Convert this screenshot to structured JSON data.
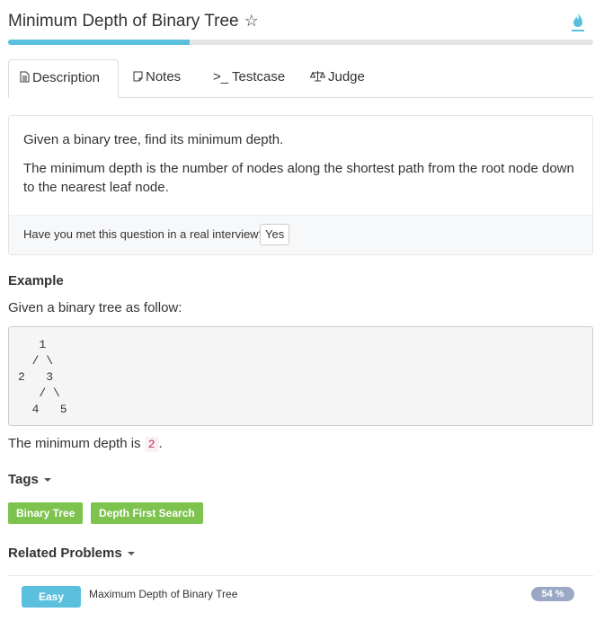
{
  "header": {
    "title": "Minimum Depth of Binary Tree",
    "star_icon": "☆",
    "accent": "#5bc0de"
  },
  "progress": {
    "value_percent": 31
  },
  "tabs": [
    {
      "icon": "document-icon",
      "label": "Description"
    },
    {
      "icon": "note-icon",
      "label": "Notes"
    },
    {
      "icon": "terminal-icon",
      "label": ">_ Testcase"
    },
    {
      "icon": "scale-icon",
      "label": "Judge"
    }
  ],
  "description": {
    "line1": "Given a binary tree, find its minimum depth.",
    "line2": "The minimum depth is the number of nodes along the shortest path from the root node down to the nearest leaf node.",
    "interview_question": "Have you met this question in a real interview?",
    "yes_label": "Yes"
  },
  "example": {
    "heading": "Example",
    "intro": "Given a binary tree as follow:",
    "tree": "   1\n  / \\\n2   3\n   / \\\n  4   5",
    "result_prefix": "The minimum depth is",
    "result_value": "2",
    "result_suffix": "."
  },
  "tags": {
    "heading": "Tags",
    "items": [
      "Binary Tree",
      "Depth First Search"
    ],
    "color": "#7dc34d"
  },
  "related": {
    "heading": "Related Problems",
    "items": [
      {
        "difficulty": "Easy",
        "title": "Maximum Depth of Binary Tree",
        "percent": "54 %"
      }
    ]
  }
}
